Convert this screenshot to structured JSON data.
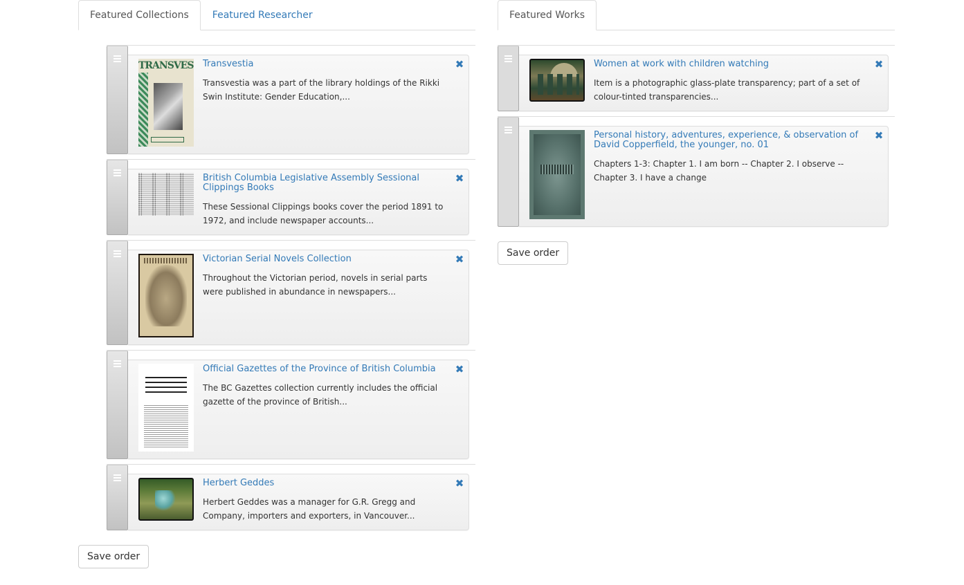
{
  "left": {
    "tabs": [
      {
        "label": "Featured Collections",
        "active": true
      },
      {
        "label": "Featured Researcher",
        "active": false
      }
    ],
    "items": [
      {
        "title": "Transvestia",
        "description": "Transvestia was a part of the library holdings of the Rikki Swin Institute: Gender Education,...",
        "thumbnail": "magazine-cover-thumbnail"
      },
      {
        "title": "British Columbia Legislative Assembly Sessional Clippings Books",
        "description": "These Sessional Clippings books cover the period 1891 to 1972, and include newspaper accounts...",
        "thumbnail": "newspaper-clipping-thumbnail"
      },
      {
        "title": "Victorian Serial Novels Collection",
        "description": "Throughout the Victorian period, novels in serial parts were published in abundance in newspapers...",
        "thumbnail": "serial-novel-cover-thumbnail"
      },
      {
        "title": "Official Gazettes of the Province of British Columbia",
        "description": "The BC Gazettes collection currently includes the official gazette of the province of British...",
        "thumbnail": "gazette-page-thumbnail"
      },
      {
        "title": "Herbert Geddes",
        "description": "Herbert Geddes was a manager for G.R. Gregg and Company, importers and exporters, in Vancouver...",
        "thumbnail": "field-photo-thumbnail"
      }
    ],
    "save_label": "Save order"
  },
  "right": {
    "tabs": [
      {
        "label": "Featured Works",
        "active": true
      }
    ],
    "items": [
      {
        "title": "Women at work with children watching",
        "description": "Item is a photographic glass-plate transparency; part of a set of colour-tinted transparencies...",
        "thumbnail": "village-photo-thumbnail"
      },
      {
        "title": "Personal history, adventures, experience, & observation of David Copperfield, the younger, no. 01",
        "description": "Chapters 1-3: Chapter 1. I am born -- Chapter 2. I observe -- Chapter 3. I have a change",
        "thumbnail": "book-cover-thumbnail"
      }
    ],
    "save_label": "Save order"
  },
  "icons": {
    "remove": "✖",
    "drag_handle": "≡"
  },
  "colors": {
    "link": "#337ab7",
    "text": "#333333",
    "active_tab_text": "#555555",
    "border": "#dddddd"
  }
}
